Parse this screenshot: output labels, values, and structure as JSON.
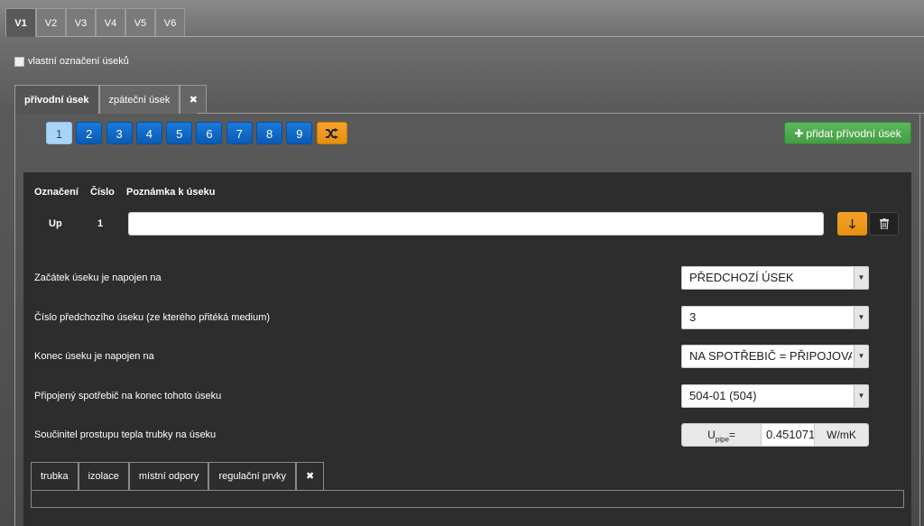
{
  "version_tabs": [
    "V1",
    "V2",
    "V3",
    "V4",
    "V5",
    "V6"
  ],
  "own_labeling_label": "vlastní označení úseků",
  "section_tabs": {
    "supply": "přívodní úsek",
    "return": "zpáteční úsek",
    "close": "✖"
  },
  "number_buttons": [
    "1",
    "2",
    "3",
    "4",
    "5",
    "6",
    "7",
    "8",
    "9"
  ],
  "add_button_label": "přidat přívodní úsek",
  "table": {
    "headers": {
      "label": "Označení",
      "number": "Číslo",
      "note": "Poznámka k úseku"
    },
    "row": {
      "label": "Up",
      "number": "1",
      "note": ""
    }
  },
  "form": {
    "start_label": "Začátek úseku je napojen na",
    "start_value": "PŘEDCHOZÍ ÚSEK",
    "prev_label": "Číslo předchozího úseku (ze kterého přitéká medium)",
    "prev_value": "3",
    "end_label": "Konec úseku je napojen na",
    "end_value": "NA SPOTŘEBIČ = PŘIPOJOVAC",
    "appliance_label": "Připojený spotřebič na konec tohoto úseku",
    "appliance_value": "504-01 (504)",
    "coef_label": "Součinitel prostupu tepla trubky na úseku",
    "coef_symbol": "U",
    "coef_sub": "pipe",
    "coef_eq": "=",
    "coef_value": "0.451071",
    "coef_unit": "W/mK"
  },
  "bottom_tabs": [
    "trubka",
    "izolace",
    "místní odpory",
    "regulační prvky"
  ],
  "bottom_close": "✖",
  "colors": {
    "primary": "#0a5bb5",
    "warning": "#f0981a",
    "success": "#4cae4c",
    "panel": "#2d2d2d"
  }
}
